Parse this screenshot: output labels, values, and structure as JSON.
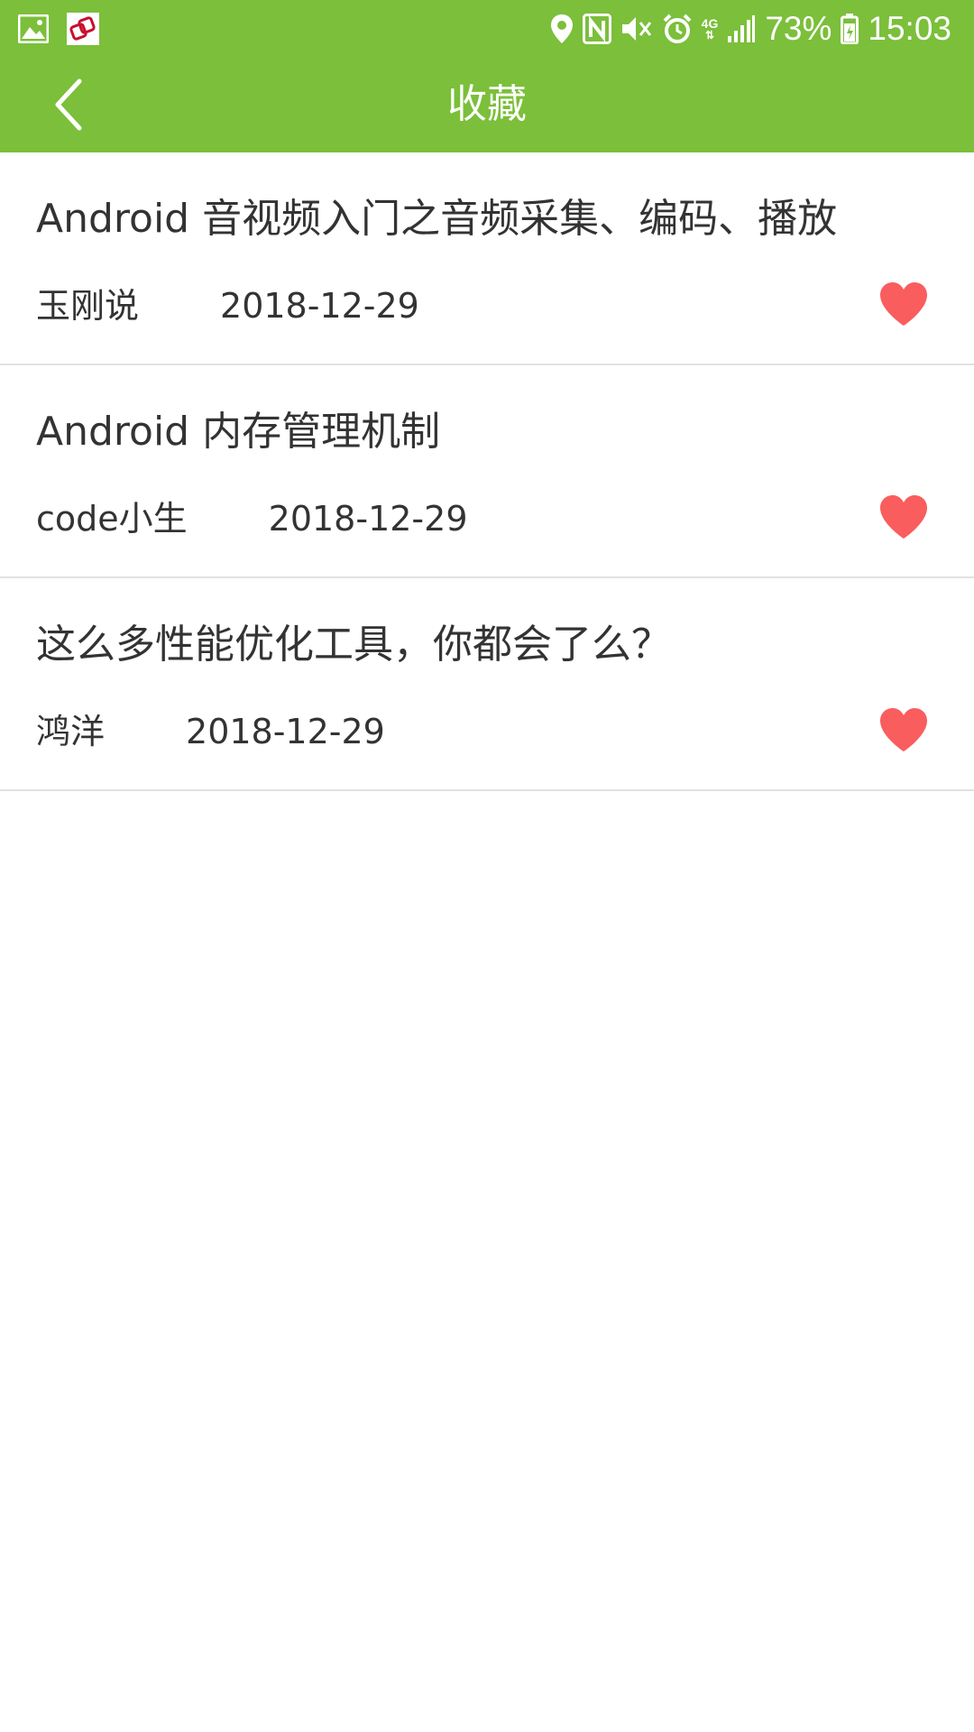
{
  "status_bar": {
    "battery": "73%",
    "time": "15:03",
    "network": "4G",
    "icons": [
      "gallery-icon",
      "link-app-icon",
      "location-icon",
      "nfc-icon",
      "mute-icon",
      "alarm-icon",
      "signal-icon",
      "battery-icon"
    ]
  },
  "header": {
    "title": "收藏",
    "back_icon": "chevron-left-icon"
  },
  "colors": {
    "accent": "#7bbf3a",
    "heart": "#fa5d5d",
    "text": "#333333",
    "divider": "#e1e1e1"
  },
  "favorites": [
    {
      "title": "Android 音视频入门之音频采集、编码、播放",
      "author": "玉刚说",
      "date": "2018-12-29"
    },
    {
      "title": "Android 内存管理机制",
      "author": "code小生",
      "date": "2018-12-29"
    },
    {
      "title": "这么多性能优化工具，你都会了么？",
      "author": "鸿洋",
      "date": "2018-12-29"
    }
  ]
}
